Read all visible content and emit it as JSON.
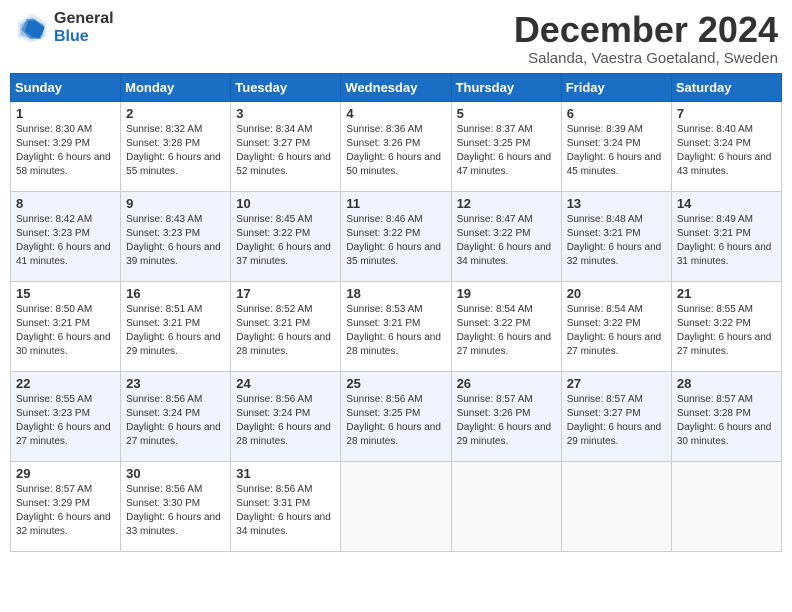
{
  "header": {
    "logo_general": "General",
    "logo_blue": "Blue",
    "month_title": "December 2024",
    "location": "Salanda, Vaestra Goetaland, Sweden"
  },
  "columns": [
    "Sunday",
    "Monday",
    "Tuesday",
    "Wednesday",
    "Thursday",
    "Friday",
    "Saturday"
  ],
  "weeks": [
    [
      {
        "day": 1,
        "sunrise": "Sunrise: 8:30 AM",
        "sunset": "Sunset: 3:29 PM",
        "daylight": "Daylight: 6 hours and 58 minutes."
      },
      {
        "day": 2,
        "sunrise": "Sunrise: 8:32 AM",
        "sunset": "Sunset: 3:28 PM",
        "daylight": "Daylight: 6 hours and 55 minutes."
      },
      {
        "day": 3,
        "sunrise": "Sunrise: 8:34 AM",
        "sunset": "Sunset: 3:27 PM",
        "daylight": "Daylight: 6 hours and 52 minutes."
      },
      {
        "day": 4,
        "sunrise": "Sunrise: 8:36 AM",
        "sunset": "Sunset: 3:26 PM",
        "daylight": "Daylight: 6 hours and 50 minutes."
      },
      {
        "day": 5,
        "sunrise": "Sunrise: 8:37 AM",
        "sunset": "Sunset: 3:25 PM",
        "daylight": "Daylight: 6 hours and 47 minutes."
      },
      {
        "day": 6,
        "sunrise": "Sunrise: 8:39 AM",
        "sunset": "Sunset: 3:24 PM",
        "daylight": "Daylight: 6 hours and 45 minutes."
      },
      {
        "day": 7,
        "sunrise": "Sunrise: 8:40 AM",
        "sunset": "Sunset: 3:24 PM",
        "daylight": "Daylight: 6 hours and 43 minutes."
      }
    ],
    [
      {
        "day": 8,
        "sunrise": "Sunrise: 8:42 AM",
        "sunset": "Sunset: 3:23 PM",
        "daylight": "Daylight: 6 hours and 41 minutes."
      },
      {
        "day": 9,
        "sunrise": "Sunrise: 8:43 AM",
        "sunset": "Sunset: 3:23 PM",
        "daylight": "Daylight: 6 hours and 39 minutes."
      },
      {
        "day": 10,
        "sunrise": "Sunrise: 8:45 AM",
        "sunset": "Sunset: 3:22 PM",
        "daylight": "Daylight: 6 hours and 37 minutes."
      },
      {
        "day": 11,
        "sunrise": "Sunrise: 8:46 AM",
        "sunset": "Sunset: 3:22 PM",
        "daylight": "Daylight: 6 hours and 35 minutes."
      },
      {
        "day": 12,
        "sunrise": "Sunrise: 8:47 AM",
        "sunset": "Sunset: 3:22 PM",
        "daylight": "Daylight: 6 hours and 34 minutes."
      },
      {
        "day": 13,
        "sunrise": "Sunrise: 8:48 AM",
        "sunset": "Sunset: 3:21 PM",
        "daylight": "Daylight: 6 hours and 32 minutes."
      },
      {
        "day": 14,
        "sunrise": "Sunrise: 8:49 AM",
        "sunset": "Sunset: 3:21 PM",
        "daylight": "Daylight: 6 hours and 31 minutes."
      }
    ],
    [
      {
        "day": 15,
        "sunrise": "Sunrise: 8:50 AM",
        "sunset": "Sunset: 3:21 PM",
        "daylight": "Daylight: 6 hours and 30 minutes."
      },
      {
        "day": 16,
        "sunrise": "Sunrise: 8:51 AM",
        "sunset": "Sunset: 3:21 PM",
        "daylight": "Daylight: 6 hours and 29 minutes."
      },
      {
        "day": 17,
        "sunrise": "Sunrise: 8:52 AM",
        "sunset": "Sunset: 3:21 PM",
        "daylight": "Daylight: 6 hours and 28 minutes."
      },
      {
        "day": 18,
        "sunrise": "Sunrise: 8:53 AM",
        "sunset": "Sunset: 3:21 PM",
        "daylight": "Daylight: 6 hours and 28 minutes."
      },
      {
        "day": 19,
        "sunrise": "Sunrise: 8:54 AM",
        "sunset": "Sunset: 3:22 PM",
        "daylight": "Daylight: 6 hours and 27 minutes."
      },
      {
        "day": 20,
        "sunrise": "Sunrise: 8:54 AM",
        "sunset": "Sunset: 3:22 PM",
        "daylight": "Daylight: 6 hours and 27 minutes."
      },
      {
        "day": 21,
        "sunrise": "Sunrise: 8:55 AM",
        "sunset": "Sunset: 3:22 PM",
        "daylight": "Daylight: 6 hours and 27 minutes."
      }
    ],
    [
      {
        "day": 22,
        "sunrise": "Sunrise: 8:55 AM",
        "sunset": "Sunset: 3:23 PM",
        "daylight": "Daylight: 6 hours and 27 minutes."
      },
      {
        "day": 23,
        "sunrise": "Sunrise: 8:56 AM",
        "sunset": "Sunset: 3:24 PM",
        "daylight": "Daylight: 6 hours and 27 minutes."
      },
      {
        "day": 24,
        "sunrise": "Sunrise: 8:56 AM",
        "sunset": "Sunset: 3:24 PM",
        "daylight": "Daylight: 6 hours and 28 minutes."
      },
      {
        "day": 25,
        "sunrise": "Sunrise: 8:56 AM",
        "sunset": "Sunset: 3:25 PM",
        "daylight": "Daylight: 6 hours and 28 minutes."
      },
      {
        "day": 26,
        "sunrise": "Sunrise: 8:57 AM",
        "sunset": "Sunset: 3:26 PM",
        "daylight": "Daylight: 6 hours and 29 minutes."
      },
      {
        "day": 27,
        "sunrise": "Sunrise: 8:57 AM",
        "sunset": "Sunset: 3:27 PM",
        "daylight": "Daylight: 6 hours and 29 minutes."
      },
      {
        "day": 28,
        "sunrise": "Sunrise: 8:57 AM",
        "sunset": "Sunset: 3:28 PM",
        "daylight": "Daylight: 6 hours and 30 minutes."
      }
    ],
    [
      {
        "day": 29,
        "sunrise": "Sunrise: 8:57 AM",
        "sunset": "Sunset: 3:29 PM",
        "daylight": "Daylight: 6 hours and 32 minutes."
      },
      {
        "day": 30,
        "sunrise": "Sunrise: 8:56 AM",
        "sunset": "Sunset: 3:30 PM",
        "daylight": "Daylight: 6 hours and 33 minutes."
      },
      {
        "day": 31,
        "sunrise": "Sunrise: 8:56 AM",
        "sunset": "Sunset: 3:31 PM",
        "daylight": "Daylight: 6 hours and 34 minutes."
      },
      null,
      null,
      null,
      null
    ]
  ]
}
